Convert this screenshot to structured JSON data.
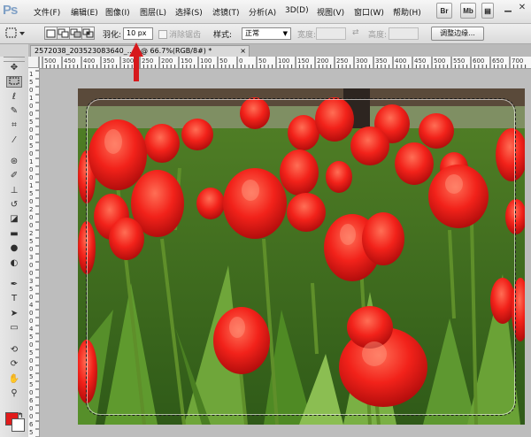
{
  "app": {
    "logo": "Ps"
  },
  "menu": [
    "文件(F)",
    "编辑(E)",
    "图像(I)",
    "图层(L)",
    "选择(S)",
    "滤镜(T)",
    "分析(A)",
    "3D(D)",
    "视图(V)",
    "窗口(W)",
    "帮助(H)"
  ],
  "top_buttons": [
    "Br",
    "Mb"
  ],
  "options": {
    "feather_label": "羽化:",
    "feather_value": "10 px",
    "antialias_label": "消除锯齿",
    "style_label": "样式:",
    "style_value": "正常",
    "width_label": "宽度:",
    "height_label": "高度:",
    "refine_edge": "调整边缘..."
  },
  "document": {
    "tab_title": "2572038_203523083640_...g @ 66.7%(RGB/8#) *",
    "close_glyph": "×"
  },
  "ruler": {
    "top": [
      "500",
      "450",
      "400",
      "350",
      "300",
      "250",
      "200",
      "150",
      "100",
      "50",
      "0",
      "50",
      "100",
      "150",
      "200",
      "250",
      "300",
      "350",
      "400",
      "450",
      "500",
      "550",
      "600",
      "650",
      "700"
    ],
    "left": [
      "1",
      "5",
      "0",
      "1",
      "0",
      "0",
      "5",
      "0",
      "0",
      "5",
      "0",
      "1",
      "0",
      "0",
      "1",
      "5",
      "0",
      "2",
      "0",
      "0",
      "2",
      "5",
      "0",
      "3",
      "0",
      "0",
      "3",
      "5",
      "0",
      "4",
      "0",
      "0",
      "4",
      "5",
      "0",
      "5",
      "0",
      "0",
      "5",
      "5",
      "0",
      "6",
      "0",
      "0",
      "6",
      "5",
      "0",
      "7"
    ]
  },
  "colors": {
    "foreground": "#e11b1b",
    "background": "#ffffff",
    "arrow": "#d7191c"
  },
  "icons": {
    "tools": [
      "move-tool-icon",
      "marquee-tool-icon",
      "lasso-tool-icon",
      "quick-select-tool-icon",
      "crop-tool-icon",
      "eyedropper-tool-icon",
      "healing-brush-icon",
      "brush-tool-icon",
      "clone-stamp-icon",
      "history-brush-icon",
      "eraser-tool-icon",
      "gradient-tool-icon",
      "blur-tool-icon",
      "dodge-tool-icon",
      "pen-tool-icon",
      "type-tool-icon",
      "path-select-icon",
      "shape-tool-icon",
      "3d-rotate-icon",
      "3d-orbit-icon",
      "hand-tool-icon",
      "zoom-tool-icon"
    ]
  }
}
